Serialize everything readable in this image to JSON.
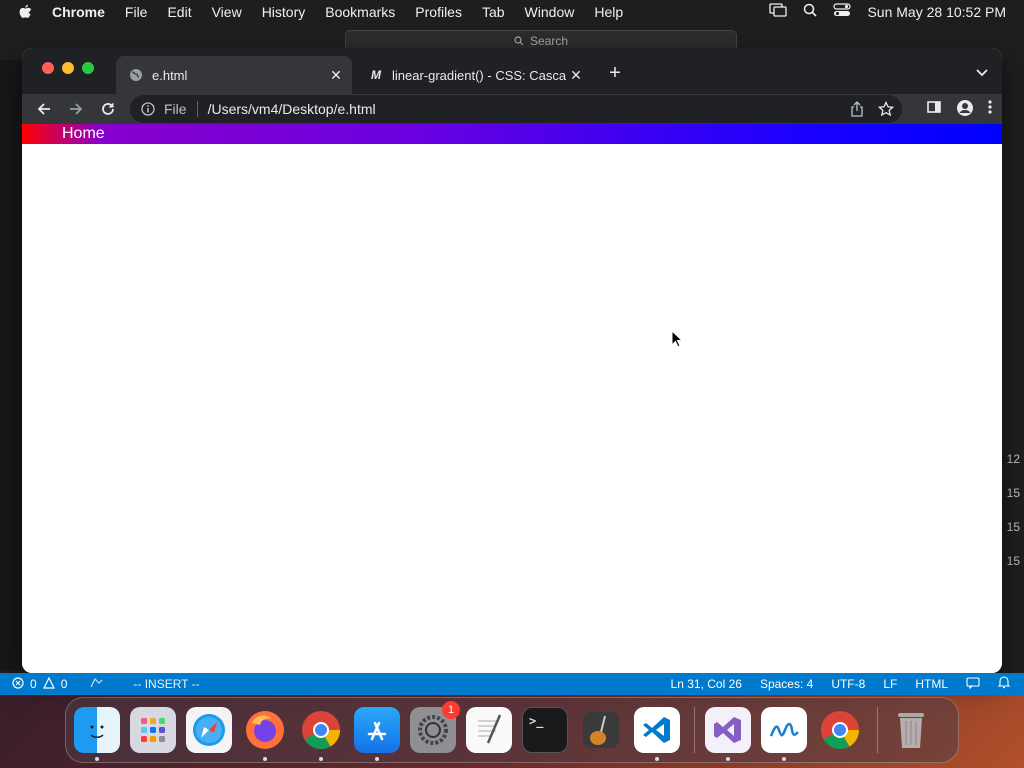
{
  "menubar": {
    "app_name": "Chrome",
    "items": [
      "File",
      "Edit",
      "View",
      "History",
      "Bookmarks",
      "Profiles",
      "Tab",
      "Window",
      "Help"
    ],
    "clock": "Sun May 28  10:52 PM"
  },
  "background_window": {
    "search_placeholder": "Search",
    "line_numbers": [
      "12",
      "15",
      "15",
      "15"
    ]
  },
  "browser": {
    "tabs": [
      {
        "title": "e.html",
        "active": true,
        "favicon": "globe-icon"
      },
      {
        "title": "linear-gradient() - CSS: Cascading Style Sheets | MDN",
        "active": false,
        "favicon": "mdn-icon"
      }
    ],
    "omnibox": {
      "scheme_label": "File",
      "url": "/Users/vm4/Desktop/e.html"
    },
    "page": {
      "nav_link": "Home"
    }
  },
  "statusbar": {
    "errors": "0",
    "warnings": "0",
    "mode": "-- INSERT --",
    "position": "Ln 31, Col 26",
    "spaces": "Spaces: 4",
    "encoding": "UTF-8",
    "eol": "LF",
    "language": "HTML"
  },
  "dock": {
    "apps": [
      "Finder",
      "Launchpad",
      "Safari",
      "Firefox",
      "Chrome",
      "App Store",
      "System Settings",
      "TextEdit",
      "Terminal",
      "GarageBand",
      "Visual Studio Code",
      "Visual Studio",
      "Freeform",
      "Chrome",
      "Trash"
    ],
    "settings_badge": "1"
  },
  "colors": {
    "gradient_start": "#ff0000",
    "gradient_end": "#0000ff",
    "statusbar": "#007acc"
  }
}
